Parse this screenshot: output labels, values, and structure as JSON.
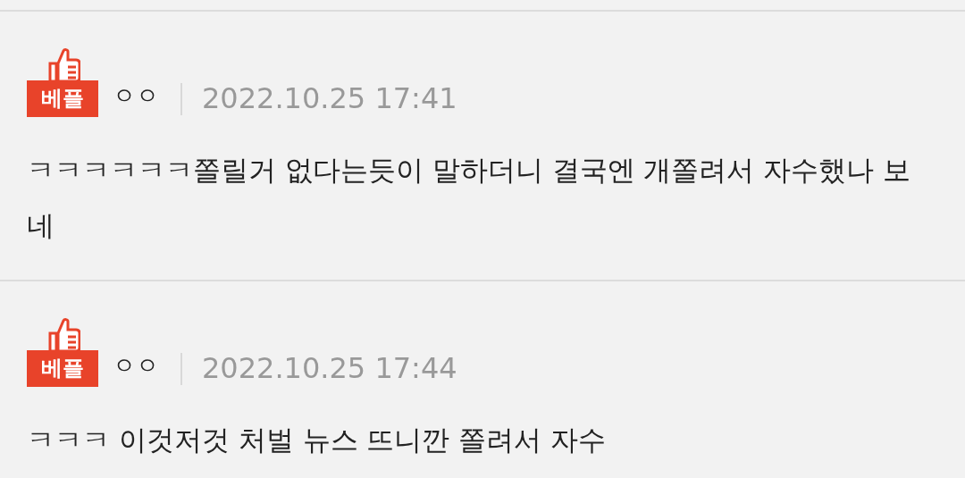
{
  "comments": [
    {
      "badge": "베플",
      "author": "ㅇㅇ",
      "date": "2022.10.25 17:41",
      "text": "ㅋㅋㅋㅋㅋㅋ쫄릴거 없다는듯이 말하더니 결국엔 개쫄려서 자수했나 보네"
    },
    {
      "badge": "베플",
      "author": "ㅇㅇ",
      "date": "2022.10.25 17:44",
      "text": "ㅋㅋㅋ 이것저것 처벌 뉴스 뜨니깐 쫄려서 자수"
    }
  ]
}
